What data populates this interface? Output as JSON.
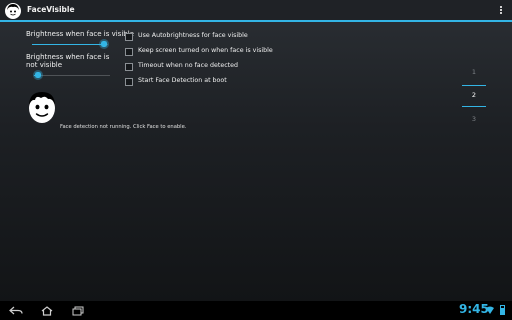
{
  "app": {
    "title": "FaceVisible",
    "accent": "#33b5e5"
  },
  "sliders": [
    {
      "label": "Brightness when face is visible",
      "value_fraction": 0.95
    },
    {
      "label": "Brightness when face is not visible",
      "value_fraction": 0.0
    }
  ],
  "options": [
    {
      "label": "Use Autobrightness for face visible",
      "checked": false
    },
    {
      "label": "Keep screen turned on when face is visible",
      "checked": false
    },
    {
      "label": "Timeout when no face detected",
      "checked": false
    },
    {
      "label": "Start Face Detection at boot",
      "checked": false
    }
  ],
  "status": {
    "message": "Face detection not running. Click Face to enable."
  },
  "pager": {
    "pages": [
      "1",
      "2",
      "3"
    ],
    "selected": "2"
  },
  "statusbar": {
    "time": "9:45"
  },
  "icons": {
    "app": "face-icon",
    "menu": "overflow-menu-icon",
    "nav_back": "back-icon",
    "nav_home": "home-icon",
    "nav_recent": "recent-apps-icon",
    "wifi": "wifi-icon",
    "battery": "battery-icon"
  }
}
